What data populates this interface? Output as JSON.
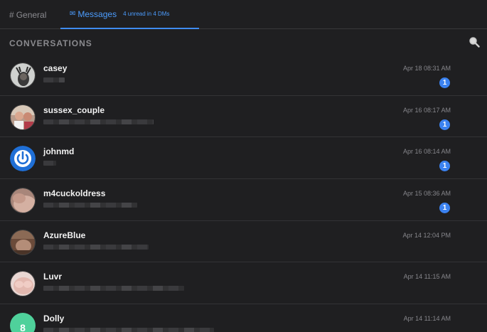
{
  "tabs": {
    "general": {
      "hash": "#",
      "label": "General"
    },
    "messages": {
      "icon": "mail-icon",
      "glyph": "✉",
      "label": "Messages",
      "unread_note": "4 unread in 4 DMs"
    }
  },
  "section": {
    "title": "CONVERSATIONS",
    "search_icon": "search-icon"
  },
  "colors": {
    "accent": "#3f8cf0",
    "badge": "#3b82f0",
    "background": "#1f1f21",
    "dolly_avatar": "#4fd19b"
  },
  "conversations": [
    {
      "name": "casey",
      "time": "Apr 18 08:31 AM",
      "unread": "1",
      "preview_width": 30,
      "avatar": "antlers-photo"
    },
    {
      "name": "sussex_couple",
      "time": "Apr 16 08:17 AM",
      "unread": "1",
      "preview_width": 155,
      "avatar": "couple-photo"
    },
    {
      "name": "johnmd",
      "time": "Apr 16 08:14 AM",
      "unread": "1",
      "preview_width": 18,
      "avatar": "power-logo"
    },
    {
      "name": "m4cuckoldress",
      "time": "Apr 15 08:36 AM",
      "unread": "1",
      "preview_width": 132,
      "avatar": "skin-photo"
    },
    {
      "name": "AzureBlue",
      "time": "Apr 14 12:04 PM",
      "unread": "",
      "preview_width": 148,
      "avatar": "brown-photo"
    },
    {
      "name": "Luvr",
      "time": "Apr 14 11:15 AM",
      "unread": "",
      "preview_width": 198,
      "avatar": "pink-photo"
    },
    {
      "name": "Dolly",
      "time": "Apr 14 11:14 AM",
      "unread": "",
      "preview_width": 240,
      "avatar_letter": "8",
      "avatar": "letter-avatar"
    }
  ]
}
